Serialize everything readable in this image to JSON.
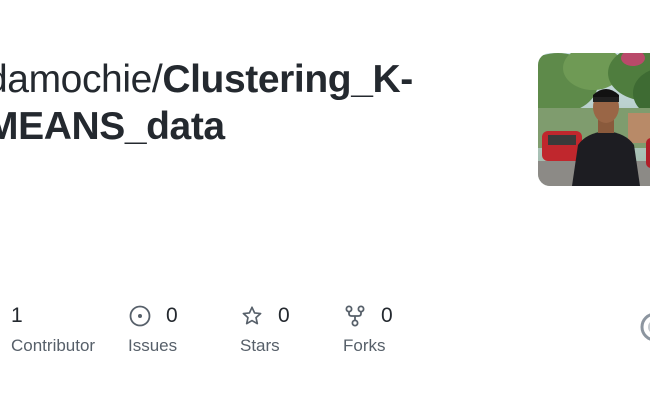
{
  "repo": {
    "owner": "damochie",
    "separator": "/",
    "name_line1": "Clustering_K-",
    "name_line2": "MEANS_data"
  },
  "avatar": {
    "alt": "damochie avatar"
  },
  "stats": {
    "contributors": {
      "value": "1",
      "label": "Contributor"
    },
    "issues": {
      "value": "0",
      "label": "Issues",
      "icon": "issue-opened-icon"
    },
    "stars": {
      "value": "0",
      "label": "Stars",
      "icon": "star-icon"
    },
    "forks": {
      "value": "0",
      "label": "Forks",
      "icon": "repo-forked-icon"
    }
  },
  "colors": {
    "text_primary": "#24292f",
    "text_muted": "#57606a",
    "background": "#ffffff"
  }
}
